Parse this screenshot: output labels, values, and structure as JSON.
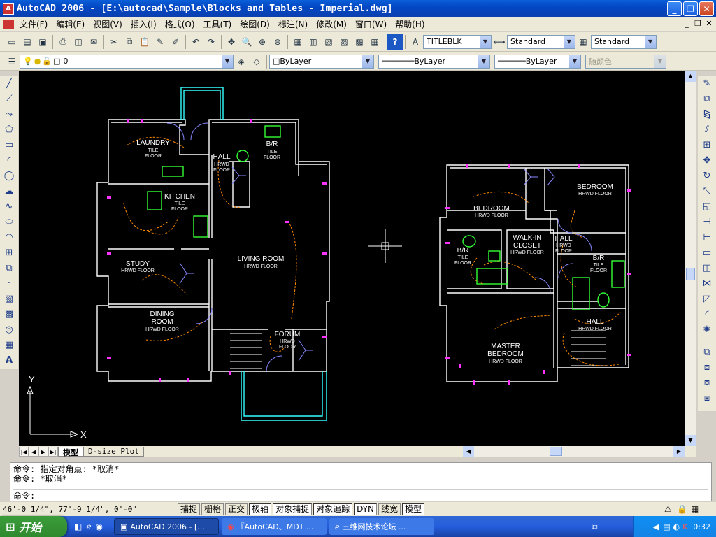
{
  "window": {
    "title": "AutoCAD 2006 - [E:\\autocad\\Sample\\Blocks and Tables - Imperial.dwg]",
    "app_icon_text": "A"
  },
  "menu": [
    "文件(F)",
    "编辑(E)",
    "视图(V)",
    "插入(I)",
    "格式(O)",
    "工具(T)",
    "绘图(D)",
    "标注(N)",
    "修改(M)",
    "窗口(W)",
    "帮助(H)"
  ],
  "toolbar_top": {
    "text_style": "TITLEBLK",
    "dim_style": "Standard",
    "table_style": "Standard"
  },
  "toolbar_layers": {
    "layer": "0",
    "color": "ByLayer",
    "linetype": "ByLayer",
    "lineweight": "ByLayer",
    "plotstyle": "随颜色"
  },
  "drawing": {
    "rooms_left": {
      "laundry": [
        "LAUNDRY",
        "TILE",
        "FLOOR"
      ],
      "br1": [
        "B/R",
        "TILE",
        "FLOOR"
      ],
      "hall1": [
        "HALL",
        "HRWD",
        "FLOOR"
      ],
      "kitchen": [
        "KITCHEN",
        "TILE",
        "FLOOR"
      ],
      "living": [
        "LIVING ROOM",
        "HRWD FLOOR"
      ],
      "study": [
        "STUDY",
        "HRWD FLOOR"
      ],
      "dining": [
        "DINING",
        "ROOM",
        "HRWD FLOOR"
      ],
      "forum": [
        "FORUM",
        "HRWD",
        "FLOOR"
      ]
    },
    "rooms_right": {
      "bedroom1": [
        "BEDROOM",
        "HRWD FLOOR"
      ],
      "bedroom2": [
        "BEDROOM",
        "HRWD FLOOR"
      ],
      "closet": [
        "WALK-IN",
        "CLOSET",
        "HRWD FLOOR"
      ],
      "hall2": [
        "HALL",
        "HRWD",
        "FLOOR"
      ],
      "br2": [
        "B/R",
        "TILE",
        "FLOOR"
      ],
      "br3": [
        "B/R",
        "TILE",
        "FLOOR"
      ],
      "hall3": [
        "HALL",
        "HRWD FLOOR"
      ],
      "master": [
        "MASTER",
        "BEDROOM",
        "HRWD FLOOR"
      ]
    },
    "ucs": {
      "x": "X",
      "y": "Y"
    }
  },
  "tabs": {
    "model": "模型",
    "layout": "D-size Plot"
  },
  "command": {
    "lines": [
      "命令: 指定对角点: *取消*",
      "命令: *取消*"
    ],
    "prompt": "命令:"
  },
  "status": {
    "coords": "46'-0 1/4\",  77'-9 1/4\", 0'-0\"",
    "buttons": [
      "捕捉",
      "栅格",
      "正交",
      "极轴",
      "对象捕捉",
      "对象追踪",
      "DYN",
      "线宽",
      "模型"
    ]
  },
  "taskbar": {
    "start": "开始",
    "tasks": [
      "AutoCAD 2006 - [...",
      "『AutoCAD、MDT ...",
      "三维网技术论坛 ..."
    ],
    "clock": "0:32"
  },
  "colors": {
    "titlebar": "#0a5fd8",
    "canvas": "#000000",
    "wall": "#ffffff",
    "wiring": "#ff8a00",
    "fixture": "#ff33ff",
    "tag": "#3344ff",
    "cyan": "#33ffff",
    "green": "#33ff33"
  }
}
